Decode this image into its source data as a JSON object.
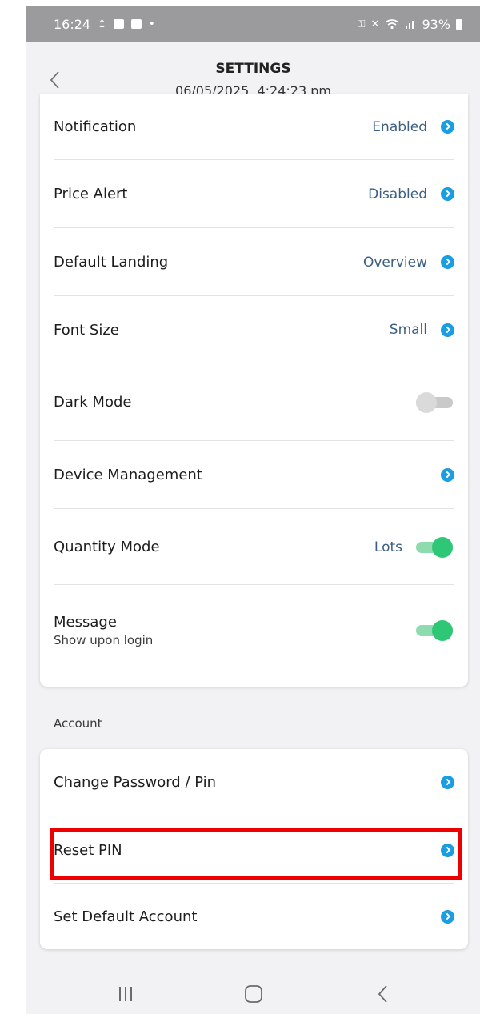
{
  "status_bar": {
    "time": "16:24",
    "left_icons": [
      "upload-icon",
      "image-icon",
      "checkbox-icon",
      "dot-icon"
    ],
    "right_icons": [
      "key-icon",
      "mute-icon",
      "wifi-icon",
      "signal-icon"
    ],
    "battery": "93%"
  },
  "header": {
    "title": "SETTINGS",
    "subtitle": "06/05/2025, 4:24:23 pm",
    "back_icon": "chevron-left-icon"
  },
  "settings": {
    "items": [
      {
        "label": "Notification",
        "value": "Enabled",
        "control": "chevron"
      },
      {
        "label": "Price Alert",
        "value": "Disabled",
        "control": "chevron"
      },
      {
        "label": "Default Landing",
        "value": "Overview",
        "control": "chevron"
      },
      {
        "label": "Font Size",
        "value": "Small",
        "control": "chevron"
      },
      {
        "label": "Dark Mode",
        "control": "toggle",
        "on": false
      },
      {
        "label": "Device Management",
        "control": "chevron"
      },
      {
        "label": "Quantity Mode",
        "value": "Lots",
        "control": "toggle",
        "on": true
      },
      {
        "label": "Message",
        "sublabel": "Show upon login",
        "control": "toggle",
        "on": true
      }
    ]
  },
  "account": {
    "section_label": "Account",
    "items": [
      {
        "label": "Change Password / Pin"
      },
      {
        "label": "Reset PIN"
      },
      {
        "label": "Set Default Account"
      }
    ]
  },
  "nav_bar": {
    "buttons": [
      "recents-icon",
      "home-icon",
      "back-icon"
    ]
  },
  "colors": {
    "accent": "#1a9de1",
    "value_text": "#3c5f84",
    "toggle_on": "#2ec775",
    "highlight": "#ee0000"
  }
}
